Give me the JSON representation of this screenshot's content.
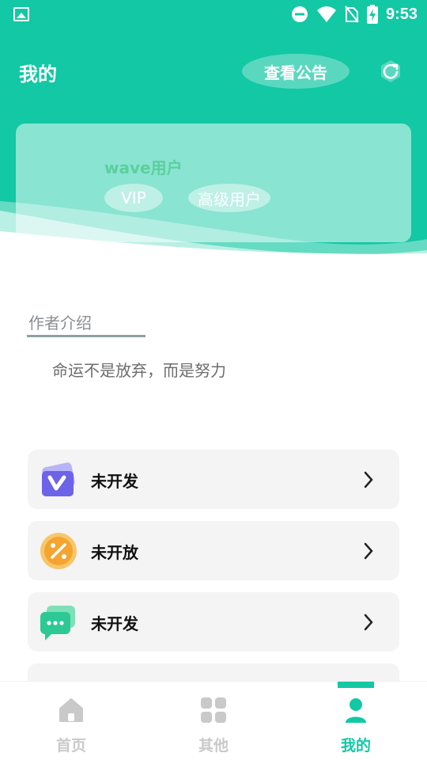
{
  "status_bar": {
    "time": "9:53"
  },
  "header": {
    "title": "我的",
    "notice_button": "查看公告",
    "refresh_icon": "refresh-icon"
  },
  "profile_card": {
    "username": "wave用户",
    "tags": [
      "VIP",
      "高级用户"
    ]
  },
  "author": {
    "section_title": "作者介绍",
    "bio": "命运不是放弃，而是努力"
  },
  "menu": {
    "items": [
      {
        "label": "未开发",
        "icon": "v-app-icon"
      },
      {
        "label": "未开放",
        "icon": "percent-coin-icon"
      },
      {
        "label": "未开发",
        "icon": "chat-bubble-icon"
      }
    ]
  },
  "tabbar": {
    "tabs": [
      {
        "label": "首页",
        "icon": "home-icon"
      },
      {
        "label": "其他",
        "icon": "grid-icon"
      },
      {
        "label": "我的",
        "icon": "user-icon"
      }
    ],
    "active_index": 2
  },
  "colors": {
    "primary": "#13c8a4",
    "username": "#5ccf9d",
    "menu_bg": "#f4f4f4",
    "tab_inactive": "#c9c9c9"
  }
}
